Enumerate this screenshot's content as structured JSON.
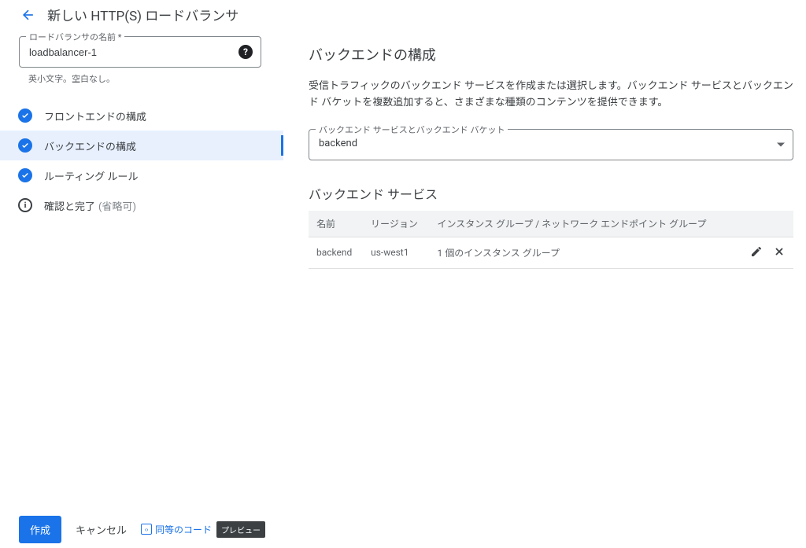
{
  "header": {
    "title": "新しい HTTP(S) ロードバランサ"
  },
  "nameField": {
    "legend": "ロードバランサの名前 *",
    "value": "loadbalancer-1",
    "hint": "英小文字。空白なし。",
    "helpGlyph": "?"
  },
  "nav": {
    "items": [
      {
        "label": "フロントエンドの構成",
        "icon": "check",
        "active": false
      },
      {
        "label": "バックエンドの構成",
        "icon": "check",
        "active": true
      },
      {
        "label": "ルーティング ルール",
        "icon": "check",
        "active": false
      },
      {
        "label": "確認と完了",
        "optional": "(省略可)",
        "icon": "info",
        "active": false
      }
    ]
  },
  "panel": {
    "title": "バックエンドの構成",
    "description": "受信トラフィックのバックエンド サービスを作成または選択します。バックエンド サービスとバックエンド バケットを複数追加すると、さまざまな種類のコンテンツを提供できます。",
    "select": {
      "legend": "バックエンド サービスとバックエンド バケット",
      "value": "backend"
    },
    "subheading": "バックエンド サービス",
    "table": {
      "headers": {
        "name": "名前",
        "region": "リージョン",
        "groups": "インスタンス グループ / ネットワーク エンドポイント グループ"
      },
      "rows": [
        {
          "name": "backend",
          "region": "us-west1",
          "groups": "1 個のインスタンス グループ"
        }
      ]
    }
  },
  "footer": {
    "create": "作成",
    "cancel": "キャンセル",
    "equivalentCode": "同等のコード",
    "preview": "プレビュー",
    "codeGlyph": "‹›"
  }
}
